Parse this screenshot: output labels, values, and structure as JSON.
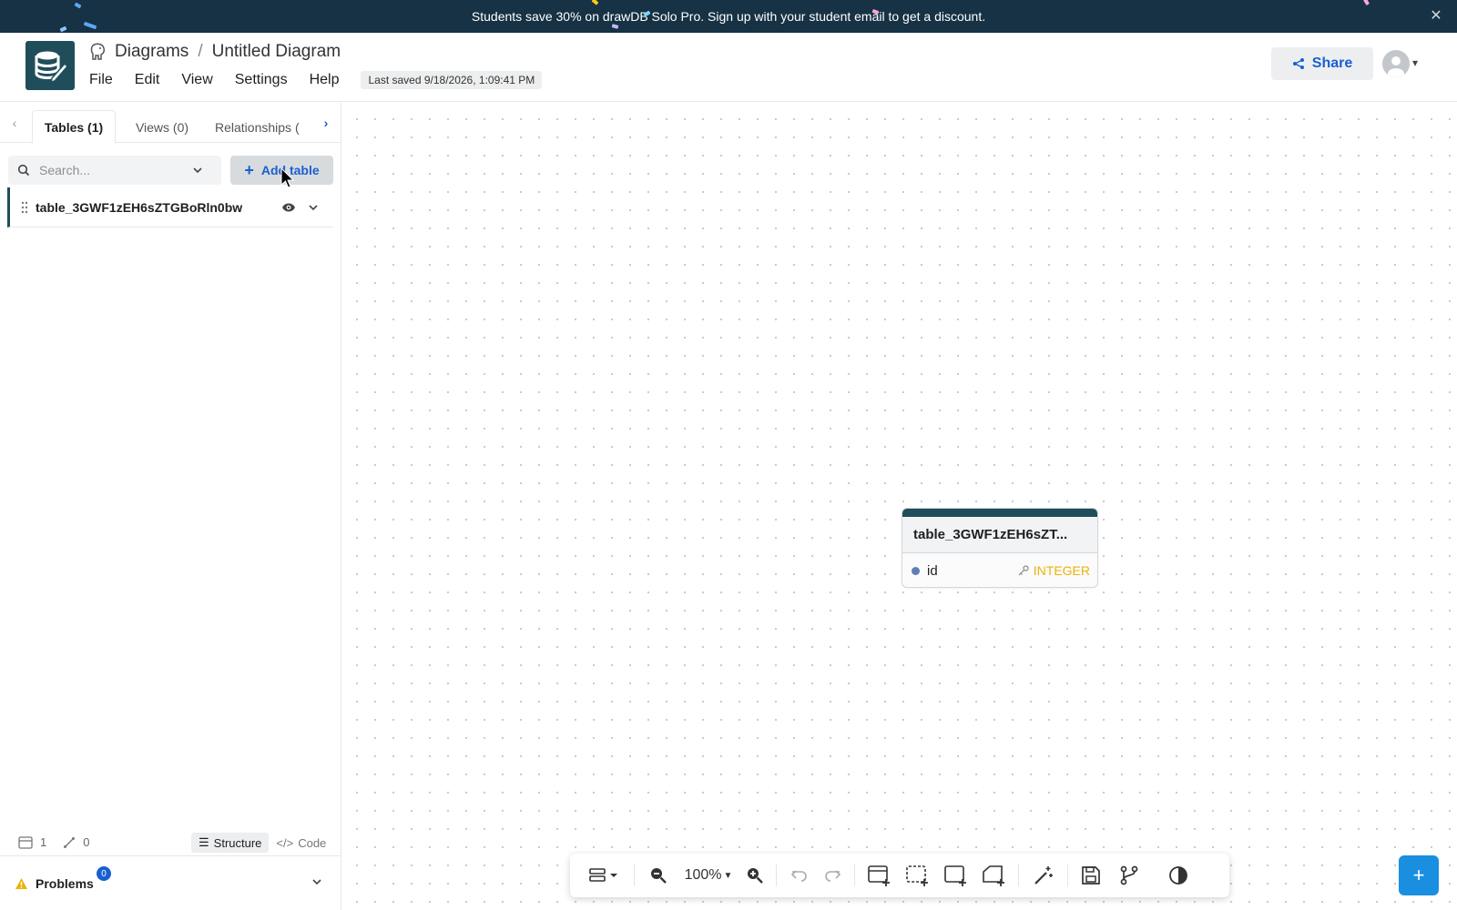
{
  "banner": {
    "text": "Students save 30% on drawDB Solo Pro. Sign up with your student email to get a discount.",
    "close_icon": "close-icon"
  },
  "header": {
    "breadcrumb_root": "Diagrams",
    "breadcrumb_separator": "/",
    "diagram_title": "Untitled Diagram",
    "menu": [
      "File",
      "Edit",
      "View",
      "Settings",
      "Help"
    ],
    "last_saved": "Last saved 9/18/2026, 1:09:41 PM",
    "share_label": "Share",
    "database_icon": "postgres-elephant-icon"
  },
  "sidebar": {
    "tabs": [
      {
        "label": "Tables (1)",
        "active": true
      },
      {
        "label": "Views (0)",
        "active": false
      },
      {
        "label": "Relationships (",
        "active": false
      }
    ],
    "search": {
      "placeholder": "Search...",
      "value": ""
    },
    "add_table_label": "Add table",
    "tables": [
      {
        "name": "table_3GWF1zEH6sZTGBoRln0bw",
        "visible": true
      }
    ],
    "stats": {
      "tables": "1",
      "relationships": "0"
    },
    "view_modes": [
      {
        "label": "Structure",
        "active": true
      },
      {
        "label": "Code",
        "active": false
      }
    ],
    "problems": {
      "label": "Problems",
      "count": "0"
    }
  },
  "canvas": {
    "table_node": {
      "title": "table_3GWF1zEH6sZT...",
      "header_color": "#1f4e5a",
      "fields": [
        {
          "name": "id",
          "type": "INTEGER",
          "primary_key": true
        }
      ]
    }
  },
  "toolbar": {
    "zoom": "100%"
  },
  "colors": {
    "accent": "#1a5fd1",
    "brand": "#1f4e5a",
    "banner_bg": "#163244",
    "type_color": "#eab308"
  }
}
